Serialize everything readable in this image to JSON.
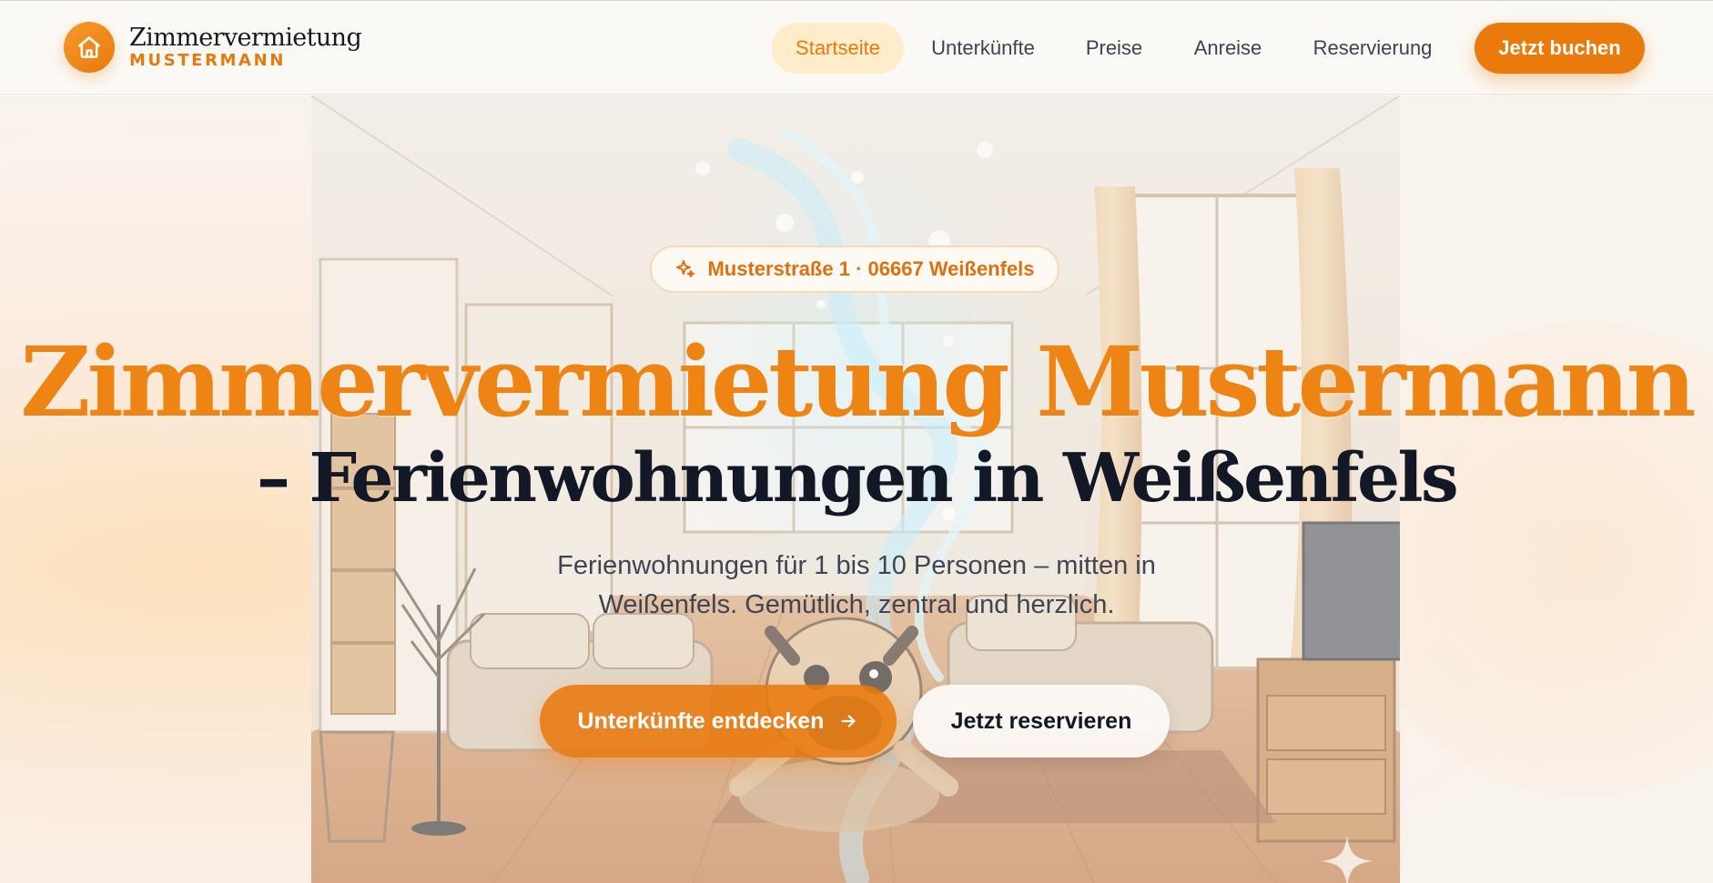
{
  "brand": {
    "name": "Zimmervermietung",
    "subtitle": "MUSTERMANN"
  },
  "nav": {
    "items": [
      {
        "label": "Startseite",
        "active": true
      },
      {
        "label": "Unterkünfte",
        "active": false
      },
      {
        "label": "Preise",
        "active": false
      },
      {
        "label": "Anreise",
        "active": false
      },
      {
        "label": "Reservierung",
        "active": false
      }
    ],
    "cta_label": "Jetzt buchen"
  },
  "hero": {
    "badge_icon": "sparkle-icon",
    "badge_text": "Musterstraße 1 · 06667 Weißenfels",
    "title_line1": "Zimmervermietung Mustermann",
    "title_line2": "– Ferienwohnungen in Weißenfels",
    "subline": "Ferienwohnungen für 1 bis 10 Personen – mitten in Weißenfels. Gemütlich, zentral und herzlich.",
    "primary_button": "Unterkünfte entdecken",
    "primary_button_icon": "arrow-right-icon",
    "secondary_button": "Jetzt reservieren"
  },
  "colors": {
    "accent": "#ea7a0c",
    "accent_light": "#feeccb",
    "title_orange": "#ee8413",
    "heading_dark": "#131827",
    "text": "#3f4555"
  }
}
